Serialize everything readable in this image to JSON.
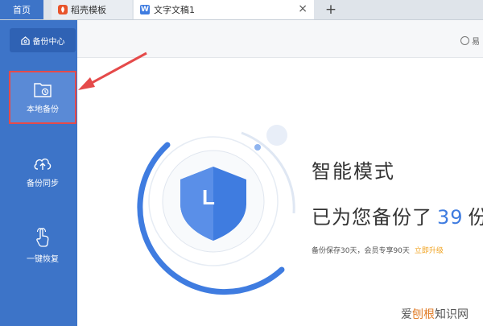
{
  "tabs": {
    "home": "首页",
    "template": "稻壳模板",
    "document": "文字文稿1",
    "doc_badge": "W",
    "close_glyph": "×",
    "add_glyph": "+"
  },
  "header": {
    "right_text": "易"
  },
  "sidebar": {
    "title": "备份中心",
    "items": [
      {
        "label": "本地备份",
        "icon": "folder-clock-icon",
        "active": true
      },
      {
        "label": "备份同步",
        "icon": "cloud-upload-icon",
        "active": false
      },
      {
        "label": "一键恢复",
        "icon": "hand-pointer-icon",
        "active": false
      }
    ]
  },
  "main": {
    "mode_title": "智能模式",
    "backup_prefix": "已为您备份了",
    "backup_count": "39",
    "backup_suffix": "份",
    "note": "备份保存30天，会员专享90天",
    "upgrade_link": "立即升级",
    "shield_letter": "L"
  },
  "watermark": {
    "part1": "爱",
    "part2": "刨根",
    "part3": "知识网"
  },
  "colors": {
    "sidebar_blue": "#3d74c8",
    "accent_blue": "#3f7ce0",
    "highlight_red": "#e54a4a",
    "upgrade_orange": "#f0a21f"
  }
}
